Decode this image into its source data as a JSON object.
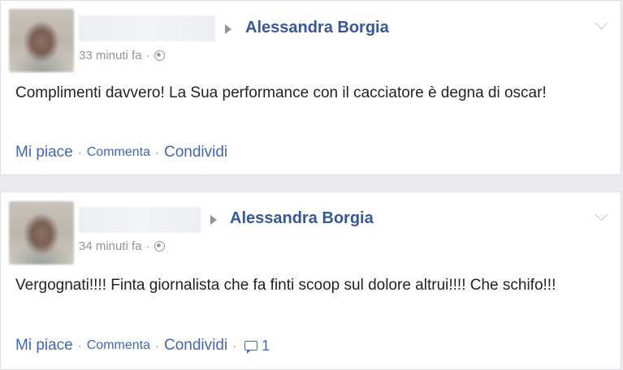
{
  "posts": [
    {
      "target": "Alessandra Borgia",
      "time": "33 minuti fa",
      "separator": "·",
      "text": "Complimenti davvero! La Sua performance con il cacciatore è degna di oscar!",
      "actions": {
        "like": "Mi piace",
        "comment": "Commenta",
        "share": "Condividi"
      }
    },
    {
      "target": "Alessandra Borgia",
      "time": "34 minuti fa",
      "separator": "·",
      "text": "Vergognati!!!! Finta giornalista che fa finti scoop sul dolore altrui!!!! Che schifo!!!",
      "actions": {
        "like": "Mi piace",
        "comment": "Commenta",
        "share": "Condividi"
      },
      "comment_count": "1"
    }
  ],
  "colors": {
    "link": "#4267b2",
    "name": "#365899",
    "meta": "#90949c",
    "text": "#1d2129",
    "background": "#e9ebee"
  },
  "icons": [
    "arrow-right-icon",
    "globe-icon",
    "chevron-down-icon",
    "comment-icon"
  ]
}
